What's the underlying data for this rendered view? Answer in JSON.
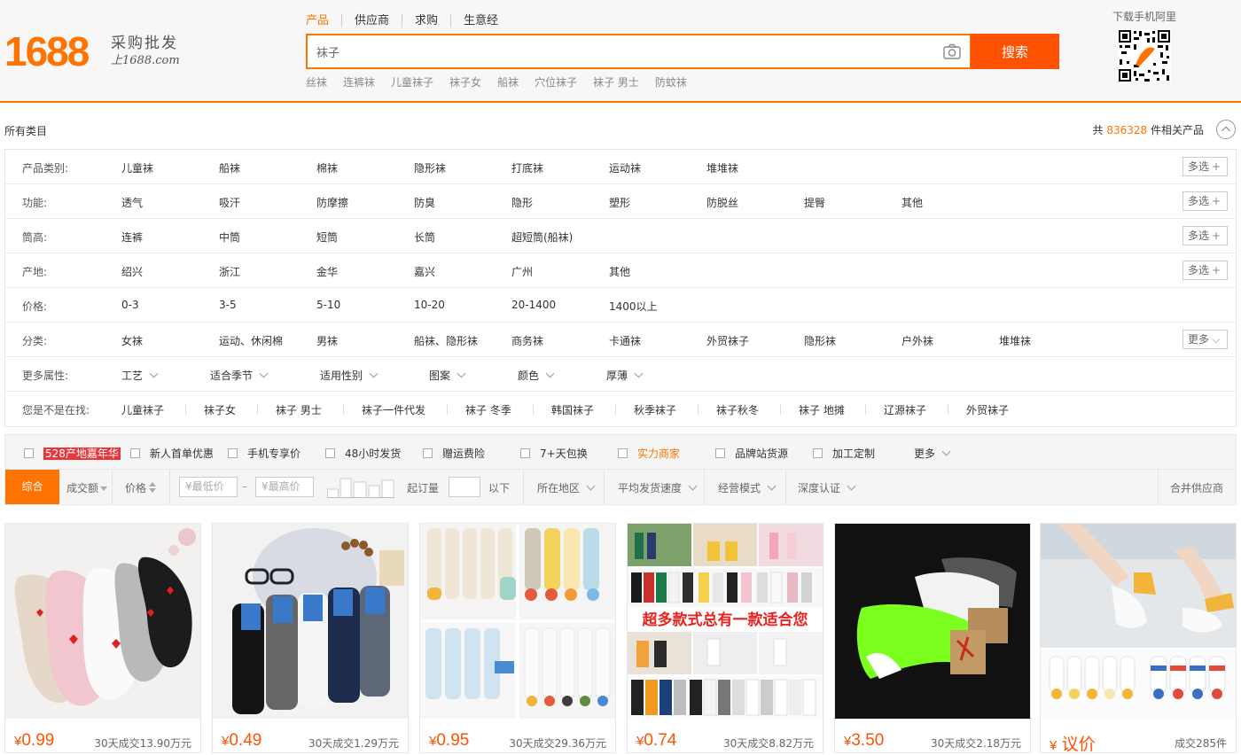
{
  "logo": {
    "number": "1688",
    "slogan_1": "采购批发",
    "slogan_2": "上1688.com"
  },
  "search": {
    "tabs": [
      "产品",
      "供应商",
      "求购",
      "生意经"
    ],
    "query": "袜子",
    "button": "搜索",
    "hot_words": [
      "丝袜",
      "连裤袜",
      "儿童袜子",
      "袜子女",
      "船袜",
      "穴位袜子",
      "袜子 男士",
      "防蚊袜"
    ]
  },
  "qr": {
    "title": "下载手机阿里"
  },
  "category_bar": {
    "all": "所有类目",
    "count_prefix": "共",
    "count": "836328",
    "count_suffix": "件相关产品"
  },
  "filters": [
    {
      "label": "产品类别:",
      "items": [
        "儿童袜",
        "船袜",
        "棉袜",
        "隐形袜",
        "打底袜",
        "运动袜",
        "堆堆袜"
      ],
      "button": "多选"
    },
    {
      "label": "功能:",
      "items": [
        "透气",
        "吸汗",
        "防摩擦",
        "防臭",
        "隐形",
        "塑形",
        "防脱丝",
        "提臀",
        "其他"
      ],
      "button": "多选"
    },
    {
      "label": "筒高:",
      "items": [
        "连裤",
        "中筒",
        "短筒",
        "长筒",
        "超短筒(船袜)"
      ],
      "button": "多选"
    },
    {
      "label": "产地:",
      "items": [
        "绍兴",
        "浙江",
        "金华",
        "嘉兴",
        "广州",
        "其他"
      ],
      "button": "多选"
    },
    {
      "label": "价格:",
      "items": [
        "0-3",
        "3-5",
        "5-10",
        "10-20",
        "20-1400",
        "1400以上"
      ],
      "button": ""
    },
    {
      "label": "分类:",
      "items": [
        "女袜",
        "运动、休闲棉",
        "男袜",
        "船袜、隐形袜",
        "商务袜",
        "卡通袜",
        "外贸袜子",
        "隐形袜",
        "户外袜",
        "堆堆袜"
      ],
      "button": "更多"
    }
  ],
  "more_attrs": {
    "label": "更多属性:",
    "items": [
      "工艺",
      "适合季节",
      "适用性别",
      "图案",
      "颜色",
      "厚薄"
    ]
  },
  "suggest": {
    "label": "您是不是在找:",
    "items": [
      "儿童袜子",
      "袜子女",
      "袜子 男士",
      "袜子一件代发",
      "袜子 冬季",
      "韩国袜子",
      "秋季袜子",
      "袜子秋冬",
      "袜子 地摊",
      "辽源袜子",
      "外贸袜子"
    ]
  },
  "services": {
    "badge": "528产地嘉年华",
    "items": [
      "新人首单优惠",
      "手机专享价",
      "48小时发货",
      "赠运费险",
      "7+天包换",
      "实力商家",
      "品牌站货源",
      "加工定制"
    ],
    "more": "更多"
  },
  "sort": {
    "main": "综合",
    "volume": "成交额",
    "price": "价格",
    "min_price": "¥最低价",
    "dash": "–",
    "max_price": "¥最高价",
    "moq": "起订量",
    "below": "以下",
    "region": "所在地区",
    "speed": "平均发货速度",
    "mode": "经营模式",
    "cert": "深度认证",
    "merge": "合并供应商"
  },
  "products": [
    {
      "price": "0.99",
      "sales": "30天成交13.90万元"
    },
    {
      "price": "0.49",
      "sales": "30天成交1.29万元"
    },
    {
      "price": "0.95",
      "sales": "30天成交29.36万元"
    },
    {
      "price": "0.74",
      "sales": "30天成交8.82万元"
    },
    {
      "price": "3.50",
      "sales": "30天成交2.18万元"
    },
    {
      "price": "议价",
      "sales": "成交285件"
    }
  ],
  "product_4_banner": "超多款式总有一款适合您",
  "colors": {
    "accent": "#ff7300",
    "search_button": "#ff5200",
    "badge": "#e4393c"
  }
}
